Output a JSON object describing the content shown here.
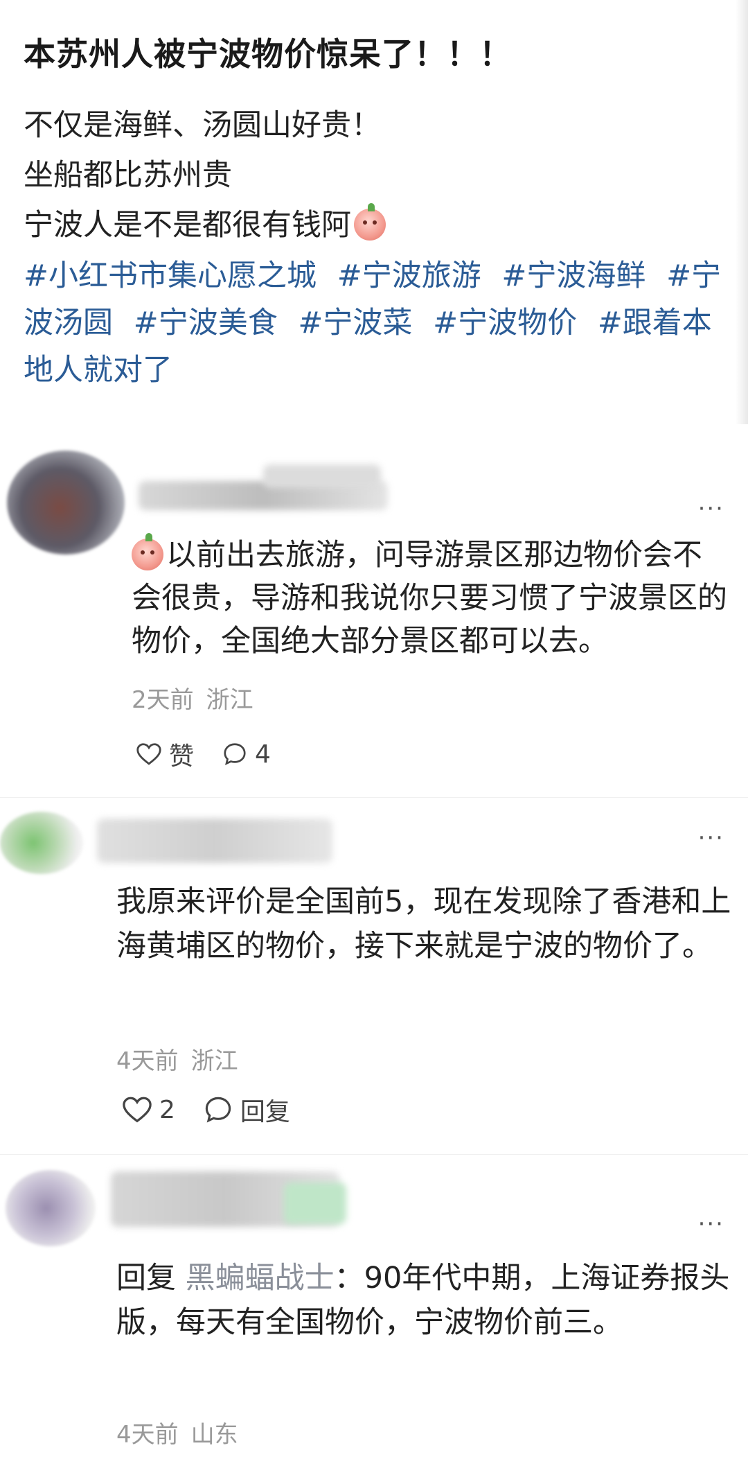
{
  "post": {
    "title": "本苏州人被宁波物价惊呆了！！！",
    "lines": [
      "不仅是海鲜、汤圆山好贵！",
      "坐船都比苏州贵",
      "宁波人是不是都很有钱阿"
    ],
    "tags": [
      "#小红书市集心愿之城",
      "#宁波旅游",
      "#宁波海鲜",
      "#宁波汤圆",
      "#宁波美食",
      "#宁波菜",
      "#宁波物价",
      "#跟着本地人就对了"
    ]
  },
  "comments": [
    {
      "text": "以前出去旅游，问导游景区那边物价会不会很贵，导游和我说你只要习惯了宁波景区的物价，全国绝大部分景区都可以去。",
      "time": "2天前",
      "location": "浙江",
      "like_label": "赞",
      "reply_label": "4",
      "more": "···"
    },
    {
      "text": "我原来评价是全国前5，现在发现除了香港和上海黄埔区的物价，接下来就是宁波的物价了。",
      "time": "4天前",
      "location": "浙江",
      "like_label": "2",
      "reply_label": "回复",
      "more": "···"
    },
    {
      "reply_prefix": "回复",
      "reply_to": "黑蝙蝠战士",
      "text": "：90年代中期，上海证券报头版，每天有全国物价，宁波物价前三。",
      "time": "4天前",
      "location": "山东",
      "more": "···"
    }
  ],
  "colors": {
    "tag": "#2b5c96",
    "meta": "#999999",
    "reply_name": "#8a8f99"
  },
  "icons": [
    "heart-icon",
    "comment-icon",
    "more-icon",
    "emoji-icon"
  ]
}
